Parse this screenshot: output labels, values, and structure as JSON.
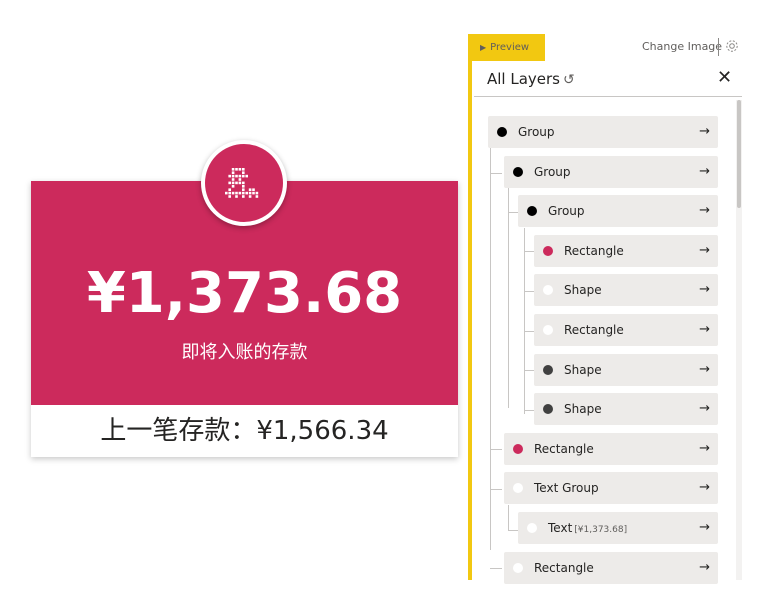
{
  "colors": {
    "card_primary": "#cc2a5c",
    "card_bottom_bg": "#ffffff",
    "accent_yellow": "#f2c811",
    "dot_black": "#000000",
    "dot_dark_gray": "#404040",
    "dot_pink": "#cc2a5c",
    "dot_white": "#ffffff"
  },
  "card": {
    "amount": "¥1,373.68",
    "caption": "即将入账的存款",
    "previous": "上一笔存款：¥1,566.34",
    "badge_icon": "pixel-glyph-icon"
  },
  "toolbar": {
    "preview_label": "Preview",
    "change_image_label": "Change Image",
    "settings_icon": "gear-icon"
  },
  "panel": {
    "title": "All Layers",
    "refresh_icon": "↺",
    "close_icon": "✕"
  },
  "layers": [
    {
      "label": "Group",
      "sub": "",
      "dot": "dot_black",
      "depth": 0
    },
    {
      "label": "Group",
      "sub": "",
      "dot": "dot_black",
      "depth": 1
    },
    {
      "label": "Group",
      "sub": "",
      "dot": "dot_black",
      "depth": 2
    },
    {
      "label": "Rectangle",
      "sub": "",
      "dot": "dot_pink",
      "depth": 3
    },
    {
      "label": "Shape",
      "sub": "",
      "dot": "dot_white",
      "depth": 3
    },
    {
      "label": "Rectangle",
      "sub": "",
      "dot": "dot_white",
      "depth": 3
    },
    {
      "label": "Shape",
      "sub": "",
      "dot": "dot_dark_gray",
      "depth": 3
    },
    {
      "label": "Shape",
      "sub": "",
      "dot": "dot_dark_gray",
      "depth": 3
    },
    {
      "label": "Rectangle",
      "sub": "",
      "dot": "dot_pink",
      "depth": 1
    },
    {
      "label": "Text Group",
      "sub": "",
      "dot": "dot_white",
      "depth": 1
    },
    {
      "label": "Text",
      "sub": "[¥1,373.68]",
      "dot": "dot_white",
      "depth": 2
    },
    {
      "label": "Rectangle",
      "sub": "",
      "dot": "dot_white",
      "depth": 1
    }
  ],
  "arrow_glyph": "→"
}
